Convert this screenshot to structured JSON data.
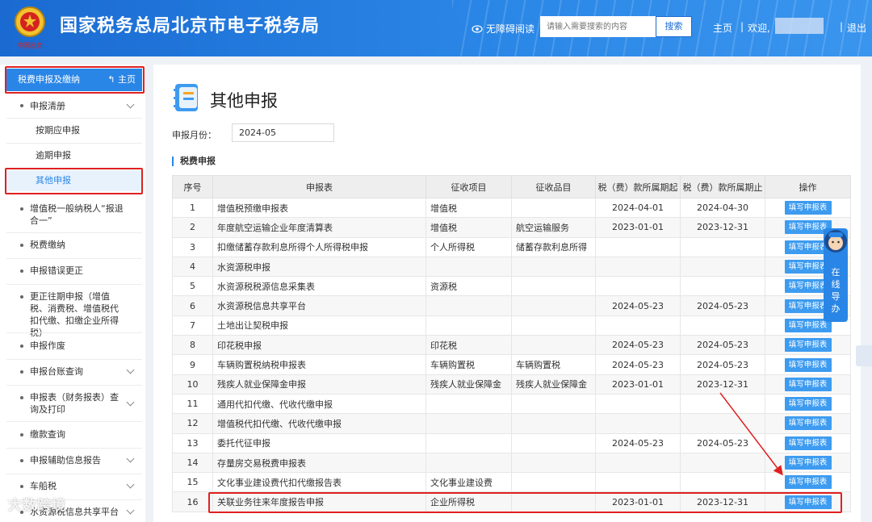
{
  "header": {
    "title": "国家税务总局北京市电子税务局",
    "emblem_caption": "中国税务",
    "accessibility": "无障碍阅读",
    "search_placeholder": "请输入需要搜索的内容",
    "search_button": "搜索",
    "home": "主页",
    "separator": "|",
    "welcome": "欢迎,",
    "logout": "退出"
  },
  "sidebar": {
    "head_label": "税费申报及缴纳",
    "head_home": "主页",
    "items": [
      {
        "label": "申报清册",
        "chevron": true
      },
      {
        "label": "按期应申报"
      },
      {
        "label": "逾期申报"
      },
      {
        "label": "其他申报"
      },
      {
        "label": "增值税一般纳税人“报退合一”"
      },
      {
        "label": "税费缴纳"
      },
      {
        "label": "申报错误更正"
      },
      {
        "label": "更正往期申报（增值税、消费税、增值税代扣代缴、扣缴企业所得税）"
      },
      {
        "label": "申报作废"
      },
      {
        "label": "申报台账查询",
        "chevron": true
      },
      {
        "label": "申报表（财务报表）查询及打印",
        "chevron": true
      },
      {
        "label": "缴款查询"
      },
      {
        "label": "申报辅助信息报告",
        "chevron": true
      },
      {
        "label": "车船税",
        "chevron": true
      },
      {
        "label": "水资源税信息共享平台",
        "chevron": true
      }
    ]
  },
  "main": {
    "page_title": "其他申报",
    "month_label": "申报月份：",
    "month_value": "2024-05",
    "section_title": "税费申报",
    "columns": [
      "序号",
      "申报表",
      "征收项目",
      "征收品目",
      "税（费）款所属期起",
      "税（费）款所属期止",
      "操作"
    ],
    "action_label": "填写申报表",
    "rows": [
      [
        "1",
        "增值税预缴申报表",
        "增值税",
        "",
        "2024-04-01",
        "2024-04-30"
      ],
      [
        "2",
        "年度航空运输企业年度清算表",
        "增值税",
        "航空运输服务",
        "2023-01-01",
        "2023-12-31"
      ],
      [
        "3",
        "扣缴储蓄存款利息所得个人所得税申报",
        "个人所得税",
        "储蓄存款利息所得",
        "",
        ""
      ],
      [
        "4",
        "水资源税申报",
        "",
        "",
        "",
        ""
      ],
      [
        "5",
        "水资源税税源信息采集表",
        "资源税",
        "",
        "",
        ""
      ],
      [
        "6",
        "水资源税信息共享平台",
        "",
        "",
        "2024-05-23",
        "2024-05-23"
      ],
      [
        "7",
        "土地出让契税申报",
        "",
        "",
        "",
        ""
      ],
      [
        "8",
        "印花税申报",
        "印花税",
        "",
        "2024-05-23",
        "2024-05-23"
      ],
      [
        "9",
        "车辆购置税纳税申报表",
        "车辆购置税",
        "车辆购置税",
        "2024-05-23",
        "2024-05-23"
      ],
      [
        "10",
        "残疾人就业保障金申报",
        "残疾人就业保障金",
        "残疾人就业保障金",
        "2023-01-01",
        "2023-12-31"
      ],
      [
        "11",
        "通用代扣代缴、代收代缴申报",
        "",
        "",
        "",
        ""
      ],
      [
        "12",
        "增值税代扣代缴、代收代缴申报",
        "",
        "",
        "",
        ""
      ],
      [
        "13",
        "委托代征申报",
        "",
        "",
        "2024-05-23",
        "2024-05-23"
      ],
      [
        "14",
        "存量房交易税费申报表",
        "",
        "",
        "",
        ""
      ],
      [
        "15",
        "文化事业建设费代扣代缴报告表",
        "文化事业建设费",
        "",
        "",
        ""
      ],
      [
        "16",
        "关联业务往来年度报告申报",
        "企业所得税",
        "",
        "2023-01-01",
        "2023-12-31"
      ]
    ]
  },
  "float_help": "在线导办",
  "watermark": "大数跨境",
  "colors": {
    "brand": "#2a86e6",
    "highlight": "#e02020",
    "button": "#3d9bf0"
  }
}
